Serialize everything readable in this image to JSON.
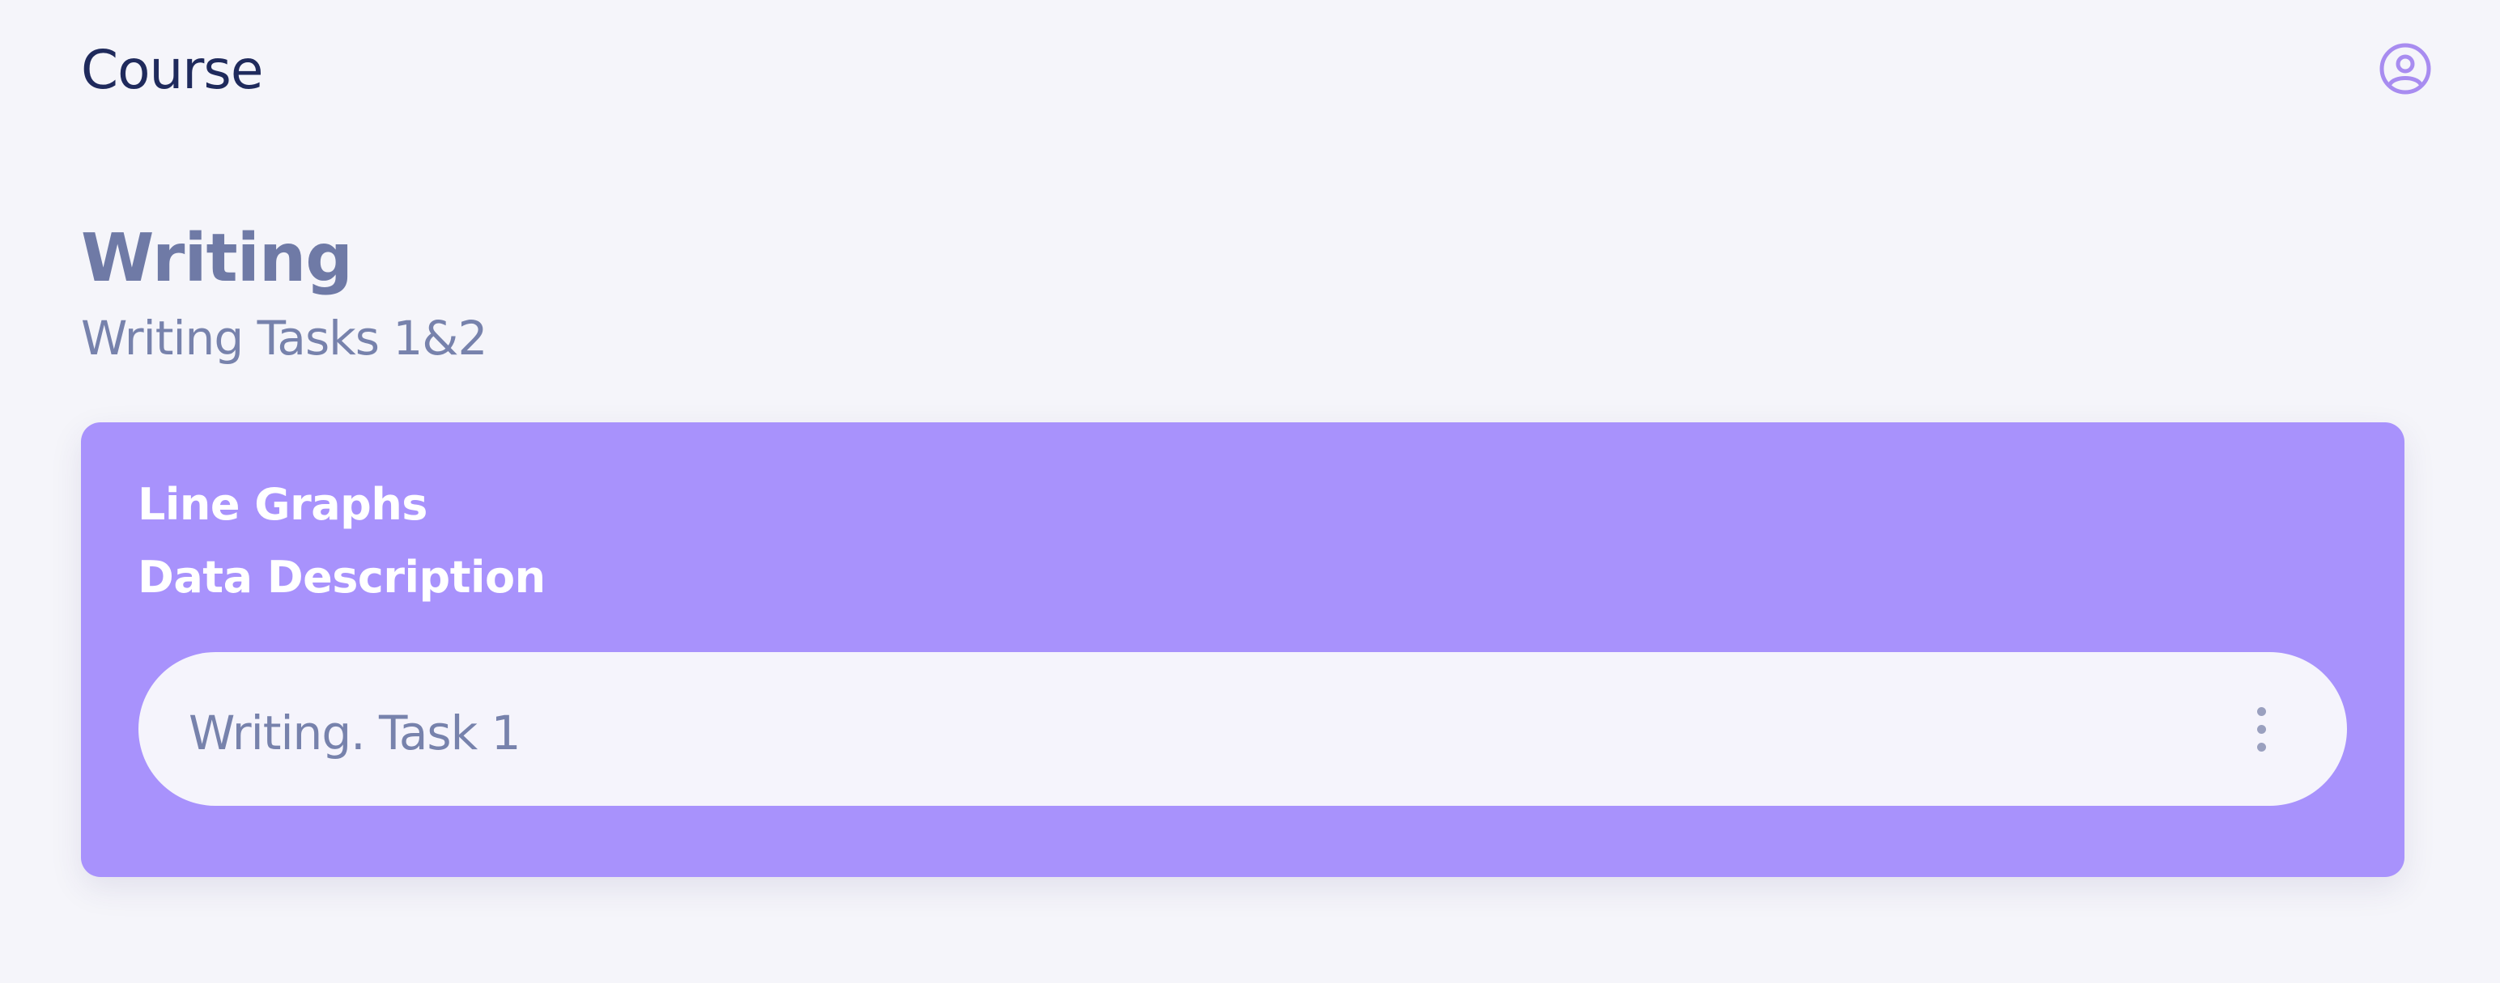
{
  "header": {
    "title": "Course",
    "profile_icon": "user-circle-icon",
    "accent_color": "#a892fc"
  },
  "section": {
    "title": "Writing",
    "subtitle": "Writing Tasks 1&2"
  },
  "card": {
    "line1": "Line Graphs",
    "line2": "Data Description",
    "background": "#a892fc",
    "items": [
      {
        "label": "Writing. Task 1",
        "menu_icon": "more-vertical-icon"
      }
    ]
  }
}
